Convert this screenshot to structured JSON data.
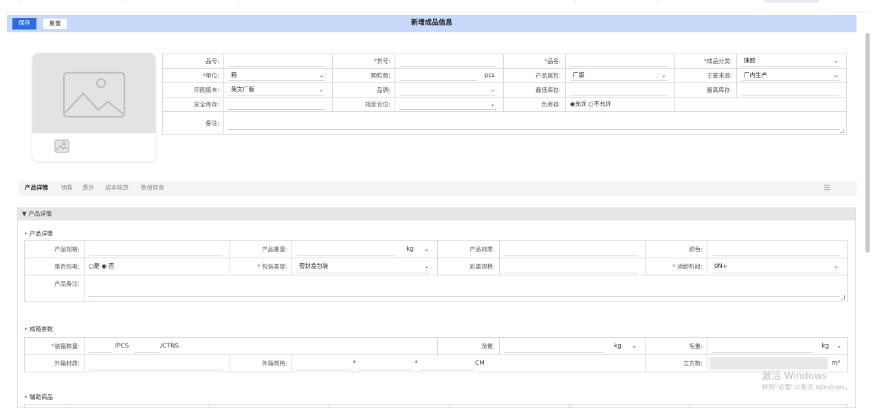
{
  "header": {
    "title": "新增成品信息",
    "save_label": "保存",
    "reset_label": "重置"
  },
  "basic": {
    "r1": [
      {
        "label": "品号:",
        "required": false,
        "value": "",
        "type": "text"
      },
      {
        "label": "货号:",
        "required": true,
        "value": "",
        "type": "text"
      },
      {
        "label": "品名:",
        "required": true,
        "value": "",
        "type": "text"
      },
      {
        "label": "成品分类:",
        "required": true,
        "value": "搪胶",
        "type": "select"
      }
    ],
    "unit_label": "单位:",
    "unit_value": "箱",
    "inspect_label": "颗粒数:",
    "inspect_unit": "pcs",
    "attr_label": "产品属性:",
    "attr_value": "厂版",
    "source_label": "主要来源:",
    "source_value": "厂内生产",
    "print_label": "印刷版本:",
    "print_value": "英文厂版",
    "brand_label": "品牌:",
    "brand_value": "",
    "min_label": "最低库存:",
    "max_label": "最高库存:",
    "safe_label": "安全库存:",
    "loc_label": "指定仓位:",
    "neg_label": "负库存:",
    "neg_allow": "允许",
    "neg_deny": "不允许",
    "remark_label": "备注:"
  },
  "tabs": [
    "产品详情",
    "销售",
    "委外",
    "成本核算",
    "数值取舍"
  ],
  "section_title": "产品详情",
  "detail": {
    "subtitle": "产品详情",
    "spec_label": "产品规格:",
    "weight_label": "产品重量:",
    "weight_unit": "kg",
    "material_label": "产品材质:",
    "color_label": "颜色:",
    "battery_label": "是否包电:",
    "battery_yes": "是",
    "battery_no": "否",
    "pack_label": "包装类型:",
    "pack_value": "密封盒包装",
    "box_label": "彩盒规格:",
    "age_label": "适龄阶段:",
    "age_value": "0N+",
    "remark_label": "产品备注:"
  },
  "carton": {
    "subtitle": "成箱参数",
    "qty_label": "装箱数量:",
    "pcs": "/PCS",
    "ctns": "/CTNS",
    "net_label": "净重:",
    "net_unit": "kg",
    "gross_label": "毛重:",
    "gross_unit": "kg",
    "outer_mat_label": "外箱材质:",
    "outer_spec_label": "外箱规格:",
    "times1": "*",
    "times2": "*",
    "cm": "CM",
    "volume_label": "立方数:",
    "volume_unit": "m³"
  },
  "aux": {
    "subtitle": "辅助商品"
  },
  "watermark": {
    "line1": "激活 Windows",
    "line2": "转到\"设置\"以激活 Windows。"
  }
}
